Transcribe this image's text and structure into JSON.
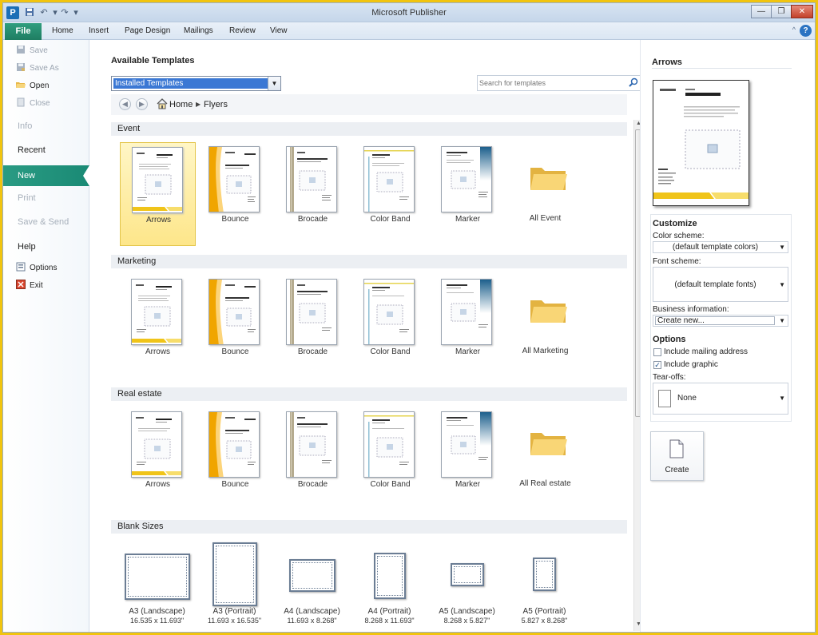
{
  "window": {
    "title": "Microsoft Publisher",
    "app_icon_letter": "P",
    "minimize_glyph": "—",
    "restore_glyph": "❐",
    "close_glyph": "✕",
    "help_glyph": "?",
    "minimize_ribbon_glyph": "^"
  },
  "ribbon": {
    "file_tab": "File",
    "tabs": [
      "Home",
      "Insert",
      "Page Design",
      "Mailings",
      "Review",
      "View"
    ]
  },
  "leftnav": {
    "commands_top": [
      {
        "label": "Save",
        "icon": "save-icon",
        "enabled": false
      },
      {
        "label": "Save As",
        "icon": "save-as-icon",
        "enabled": false
      },
      {
        "label": "Open",
        "icon": "open-folder-icon",
        "enabled": true
      },
      {
        "label": "Close",
        "icon": "close-document-icon",
        "enabled": false
      }
    ],
    "tabs": [
      {
        "label": "Info",
        "enabled": false
      },
      {
        "label": "Recent",
        "enabled": true
      },
      {
        "label": "New",
        "enabled": true,
        "selected": true
      },
      {
        "label": "Print",
        "enabled": false
      },
      {
        "label": "Save & Send",
        "enabled": false
      },
      {
        "label": "Help",
        "enabled": true
      }
    ],
    "commands_bottom": [
      {
        "label": "Options",
        "icon": "options-icon"
      },
      {
        "label": "Exit",
        "icon": "exit-icon"
      }
    ]
  },
  "center": {
    "title": "Available Templates",
    "dropdown_value": "Installed Templates",
    "dropdown_arrow": "▼",
    "search_placeholder": "Search for templates",
    "breadcrumb": {
      "back_glyph": "◀",
      "forward_glyph": "▶",
      "home": "Home",
      "separator": "▶",
      "current": "Flyers"
    },
    "sections": [
      {
        "name": "Event",
        "templates": [
          "Arrows",
          "Bounce",
          "Brocade",
          "Color Band",
          "Marker"
        ],
        "folder": "All Event"
      },
      {
        "name": "Marketing",
        "templates": [
          "Arrows",
          "Bounce",
          "Brocade",
          "Color Band",
          "Marker"
        ],
        "folder": "All Marketing"
      },
      {
        "name": "Real estate",
        "templates": [
          "Arrows",
          "Bounce",
          "Brocade",
          "Color Band",
          "Marker"
        ],
        "folder": "All Real estate"
      }
    ],
    "blank_section": "Blank Sizes",
    "blank_sizes": [
      {
        "label": "A3 (Landscape)",
        "dims": "16.535 x 11.693\""
      },
      {
        "label": "A3 (Portrait)",
        "dims": "11.693 x 16.535\""
      },
      {
        "label": "A4 (Landscape)",
        "dims": "11.693 x 8.268\""
      },
      {
        "label": "A4 (Portrait)",
        "dims": "8.268 x 11.693\""
      },
      {
        "label": "A5 (Landscape)",
        "dims": "8.268 x 5.827\""
      },
      {
        "label": "A5 (Portrait)",
        "dims": "5.827 x 8.268\""
      }
    ],
    "scroll_up": "▲",
    "scroll_down": "▼"
  },
  "preview": {
    "title": "Arrows"
  },
  "customize": {
    "heading": "Customize",
    "color_scheme_label": "Color scheme:",
    "color_scheme_value": "(default template colors)",
    "font_scheme_label": "Font scheme:",
    "font_scheme_value": "(default template fonts)",
    "business_info_label": "Business information:",
    "business_info_value": "Create new...",
    "options_heading": "Options",
    "include_mailing_label": "Include mailing address",
    "include_mailing_checked": false,
    "include_graphic_label": "Include graphic",
    "include_graphic_checked": true,
    "check_glyph": "✓",
    "tearoffs_label": "Tear-offs:",
    "tearoffs_value": "None",
    "arrow": "▼"
  },
  "create_button": {
    "label": "Create"
  },
  "colors": {
    "accent_file_tab": "#1f7d62",
    "nav_selected": "#1a8a75",
    "selected_tile": "#fde68a",
    "frame_border": "#f1c40f"
  }
}
